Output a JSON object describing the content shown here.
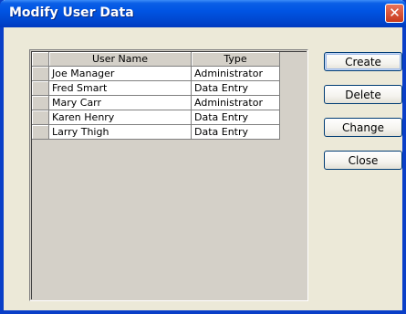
{
  "window": {
    "title": "Modify User Data",
    "close_glyph": "✕"
  },
  "grid": {
    "columns": [
      "User Name",
      "Type"
    ],
    "rows": [
      {
        "name": "Joe Manager",
        "type": "Administrator"
      },
      {
        "name": "Fred Smart",
        "type": "Data Entry"
      },
      {
        "name": "Mary Carr",
        "type": "Administrator"
      },
      {
        "name": "Karen Henry",
        "type": "Data Entry"
      },
      {
        "name": "Larry Thigh",
        "type": "Data Entry"
      }
    ]
  },
  "buttons": {
    "create": "Create",
    "delete": "Delete",
    "change": "Change",
    "close": "Close"
  },
  "colors": {
    "titlebar": "#0054e3",
    "window_bg": "#ece9d8",
    "close_button": "#c8391c"
  }
}
